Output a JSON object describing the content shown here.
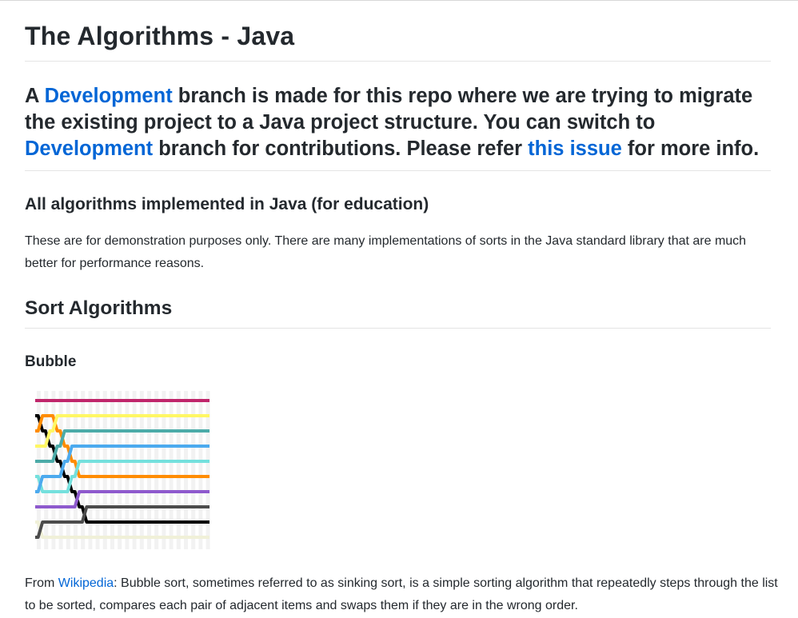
{
  "page": {
    "title": "The Algorithms - Java",
    "notice": {
      "t1": "A ",
      "link1": "Development",
      "t2": " branch is made for this repo where we are trying to migrate the existing project to a Java project structure. You can switch to ",
      "link2": "Development",
      "t3": " branch for contributions. Please refer ",
      "link3": "this issue",
      "t4": " for more info."
    },
    "section_heading": "All algorithms implemented in Java (for education)",
    "section_text": "These are for demonstration purposes only. There are many implementations of sorts in the Java standard library that are much better for performance reasons.",
    "sort_heading": "Sort Algorithms",
    "bubble_heading": "Bubble",
    "bubble_desc": {
      "prefix": "From ",
      "link": "Wikipedia",
      "text": ": Bubble sort, sometimes referred to as sinking sort, is a simple sorting algorithm that repeatedly steps through the list to be sorted, compares each pair of adjacent items and swaps them if they are in the wrong order."
    }
  },
  "colors": {
    "link": "#0366d6",
    "text": "#24292e",
    "divider": "#e4e4e4",
    "viz_colors": [
      "#ffffff",
      "#f0f0d8",
      "#000000",
      "#4c4c4c",
      "#8e5acd",
      "#ff8c00",
      "#74e0dd",
      "#4caaee",
      "#4caba8",
      "#fff764",
      "#c0266b"
    ]
  }
}
